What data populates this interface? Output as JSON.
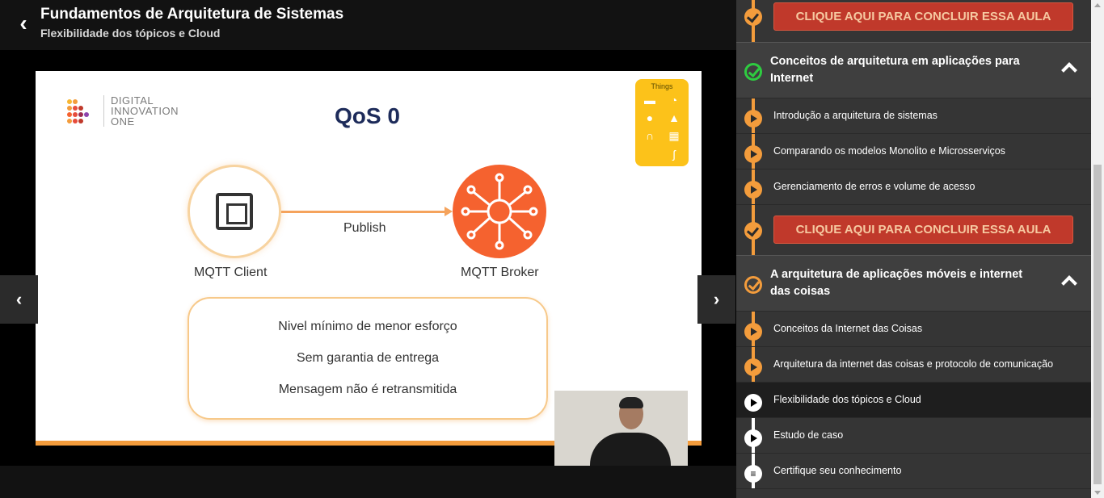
{
  "header": {
    "title": "Fundamentos de Arquitetura de Sistemas",
    "subtitle": "Flexibilidade dos tópicos e Cloud"
  },
  "slide": {
    "logo_line1": "DIGITAL",
    "logo_line2": "INNOVATION",
    "logo_line3": "ONE",
    "title": "QoS 0",
    "things_label": "Things",
    "publish": "Publish",
    "client_label": "MQTT Client",
    "broker_label": "MQTT Broker",
    "bullets": [
      "Nivel mínimo de menor esforço",
      "Sem garantia de entrega",
      "Mensagem não é retransmitida"
    ]
  },
  "sidebar": {
    "cta_label": "CLIQUE AQUI PARA CONCLUIR ESSA AULA",
    "sections": [
      {
        "title": "Conceitos de arquitetura em aplicações para Internet",
        "lessons": [
          "Introdução a arquitetura de sistemas",
          "Comparando os modelos Monolito e Microsserviços",
          "Gerenciamento de erros e volume de acesso"
        ]
      },
      {
        "title": "A arquitetura de aplicações móveis e internet das coisas",
        "lessons": [
          "Conceitos da Internet das Coisas",
          "Arquitetura da internet das coisas e protocolo de comunicação",
          "Flexibilidade dos tópicos e Cloud",
          "Estudo de caso",
          "Certifique seu conhecimento"
        ]
      }
    ]
  },
  "colors": {
    "accent": "#f39c3c",
    "cta": "#c0392b",
    "broker": "#f5622f",
    "complete": "#2ecc40"
  }
}
